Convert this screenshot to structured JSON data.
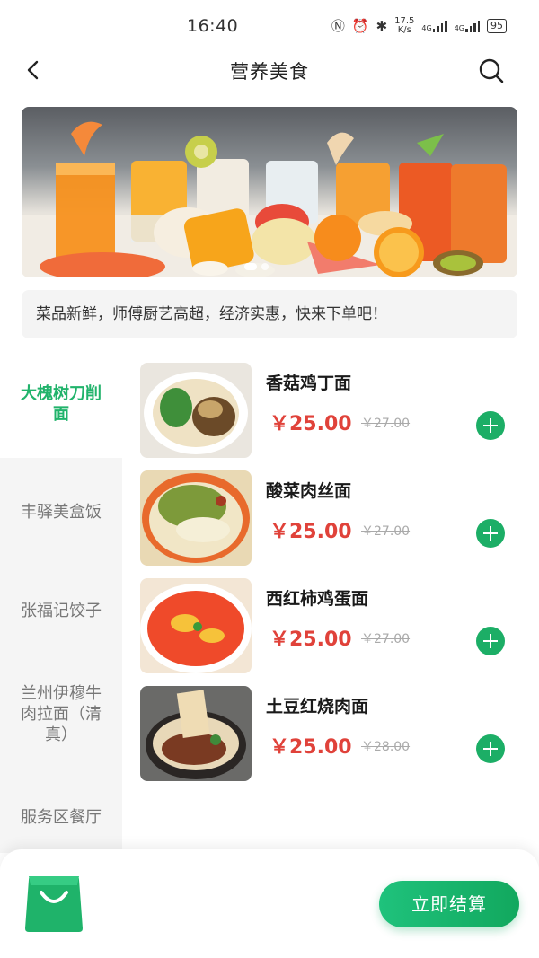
{
  "status_bar": {
    "time": "16:40",
    "speed_value": "17.5",
    "speed_unit": "K/s",
    "net1": "4G",
    "net2": "4G",
    "battery": "95"
  },
  "header": {
    "title": "营养美食",
    "back_icon": "chevron-left-icon",
    "search_icon": "search-icon"
  },
  "banner": {
    "alt": "juice-and-fruit-banner",
    "active_slide": 1,
    "slides": 2
  },
  "notice": "菜品新鲜，师傅厨艺高超，经济实惠，快来下单吧！",
  "categories": [
    {
      "label": "大槐树刀削面",
      "active": true
    },
    {
      "label": "丰驿美盒饭",
      "active": false
    },
    {
      "label": "张福记饺子",
      "active": false
    },
    {
      "label": "兰州伊穆牛肉拉面（清真）",
      "active": false
    },
    {
      "label": "服务区餐厅",
      "active": false
    }
  ],
  "items": [
    {
      "name": "香菇鸡丁面",
      "price": "￥25.00",
      "old_price": "￥27.00"
    },
    {
      "name": "酸菜肉丝面",
      "price": "￥25.00",
      "old_price": "￥27.00"
    },
    {
      "name": "西红柿鸡蛋面",
      "price": "￥25.00",
      "old_price": "￥27.00"
    },
    {
      "name": "土豆红烧肉面",
      "price": "￥25.00",
      "old_price": "￥28.00"
    }
  ],
  "bottom": {
    "cart_icon": "shopping-bag-icon",
    "checkout_label": "立即结算"
  },
  "colors": {
    "accent": "#21b36b",
    "price": "#e0423a",
    "add_button": "#1cae66"
  }
}
